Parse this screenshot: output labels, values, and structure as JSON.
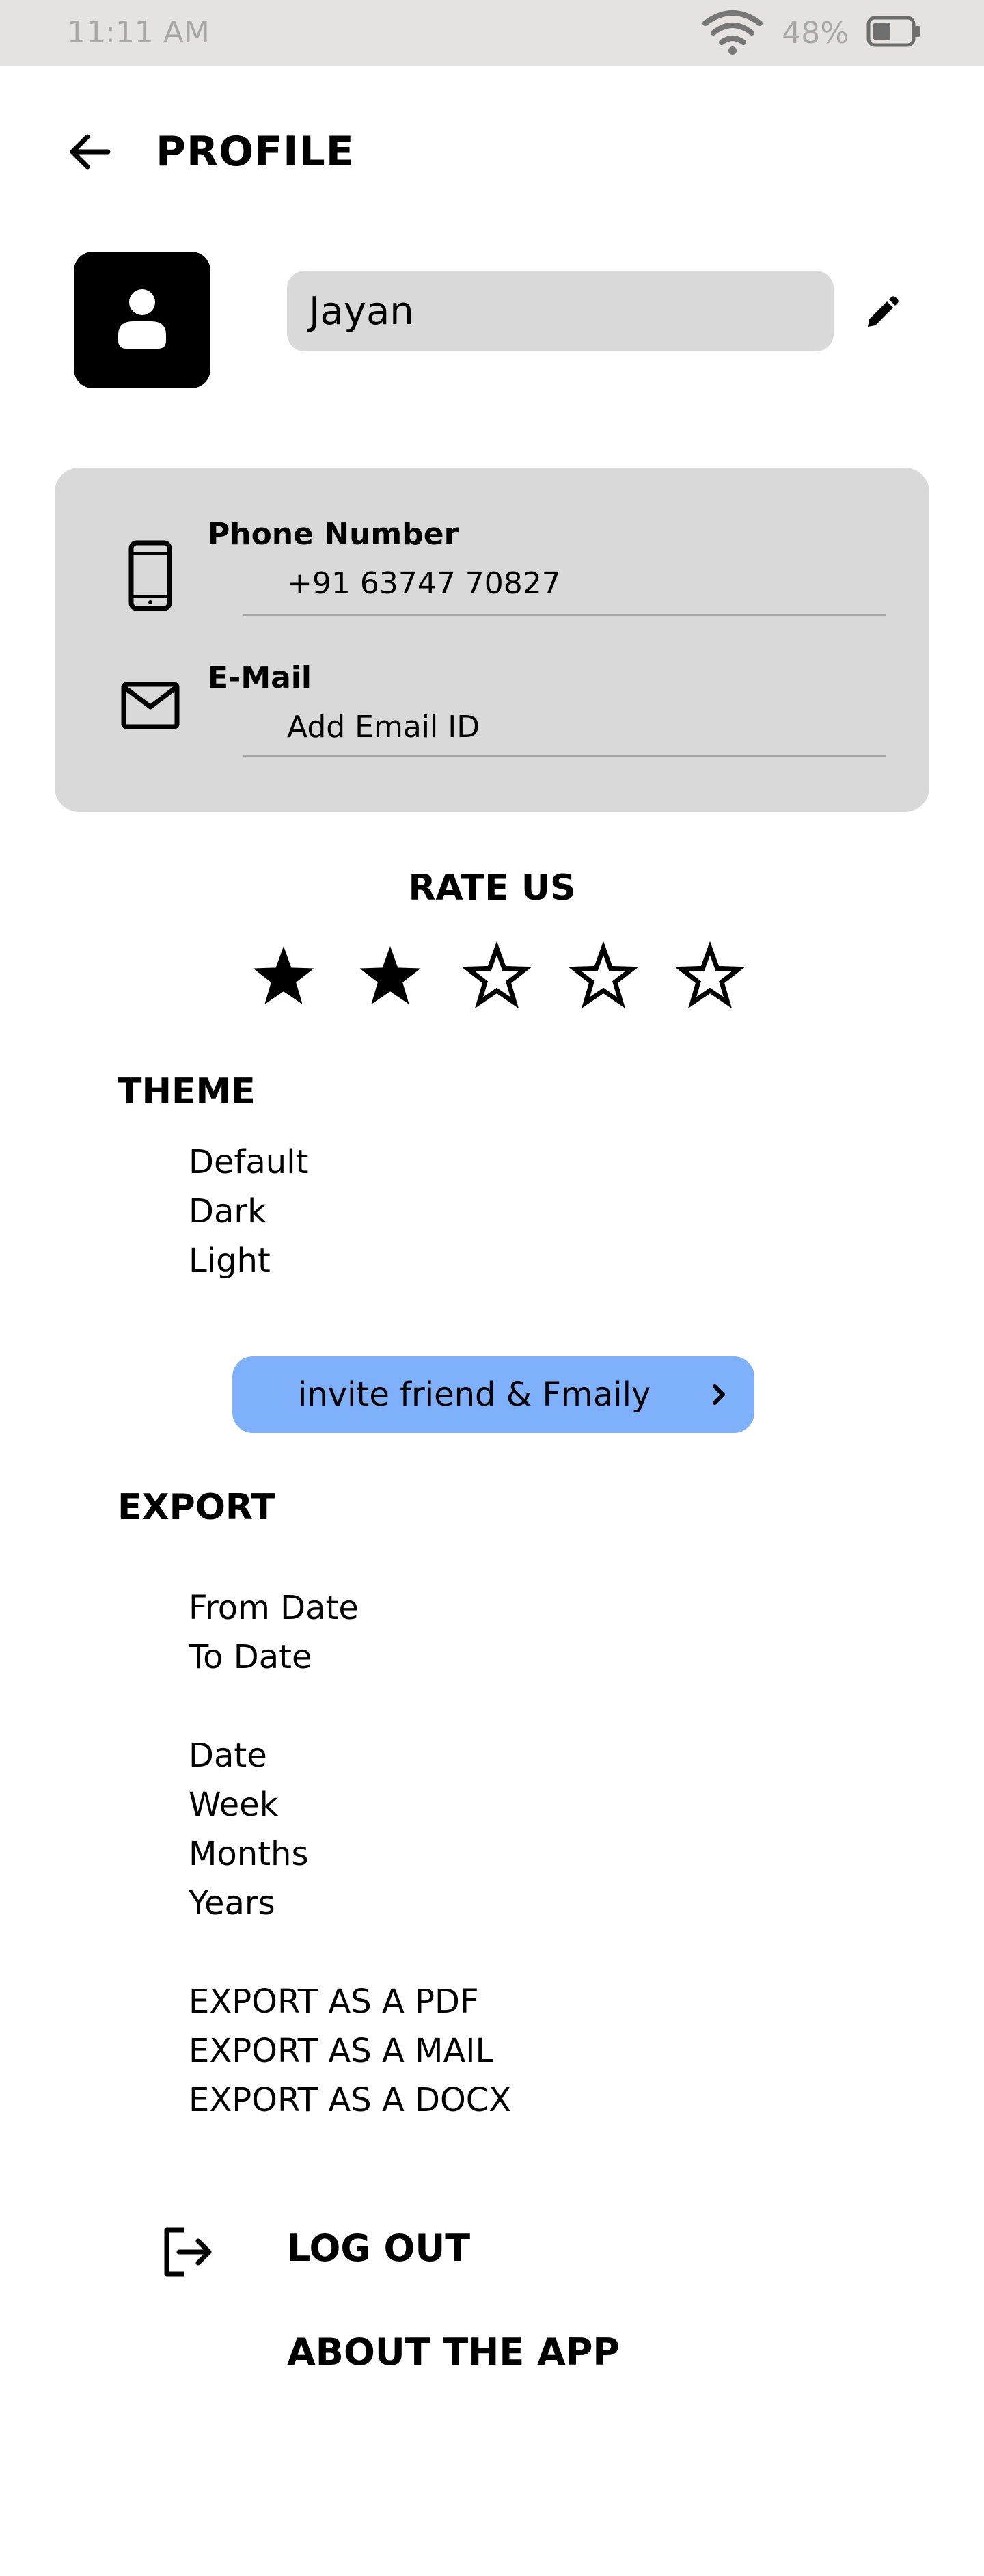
{
  "status_bar": {
    "time": "11:11 AM",
    "battery_percent": "48%",
    "icons": [
      "wifi-icon",
      "battery-icon"
    ],
    "battery_level": 0.48
  },
  "header": {
    "title": "PROFILE",
    "back_icon": "arrow-left-icon"
  },
  "profile": {
    "avatar_icon": "person-icon",
    "name": "Jayan",
    "edit_icon": "pencil-icon"
  },
  "contact": {
    "phone": {
      "label": "Phone Number",
      "value": "+91 63747 70827",
      "icon": "smartphone-icon"
    },
    "email": {
      "label": "E-Mail",
      "value": "Add Email ID",
      "icon": "mail-icon"
    }
  },
  "rating": {
    "title": "RATE US",
    "max": 5,
    "value": 2
  },
  "theme": {
    "heading": "THEME",
    "options": [
      "Default",
      "Dark",
      "Light"
    ]
  },
  "invite": {
    "label": "invite friend & Fmaily",
    "icon": "chevron-right-icon"
  },
  "export": {
    "heading": "EXPORT",
    "date_range": [
      "From Date",
      "To Date"
    ],
    "periods": [
      "Date",
      "Week",
      "Months",
      "Years"
    ],
    "formats": [
      "EXPORT AS A PDF",
      "EXPORT AS A MAIL",
      "EXPORT AS A DOCX"
    ]
  },
  "footer": {
    "logout_label": "LOG OUT",
    "logout_icon": "logout-icon",
    "about_label": "ABOUT THE APP"
  },
  "colors": {
    "status_bar_bg": "#e6e2e2",
    "card_bg": "#d9d9d9",
    "invite_button_bg": "#7eb0fb",
    "avatar_bg": "#000000"
  }
}
